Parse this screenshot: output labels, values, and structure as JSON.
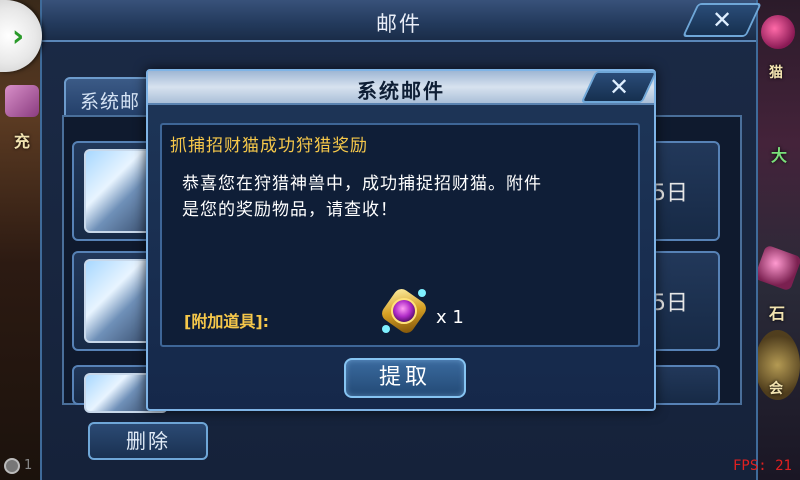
{
  "background": {
    "left_text": "充",
    "right_text_1": "猫",
    "right_text_2": "大",
    "right_text_3": "石",
    "right_text_4": "会"
  },
  "mail_panel": {
    "title": "邮件",
    "close_icon": "✕",
    "tab_label": "系统邮",
    "rows": [
      {
        "date": "5日"
      },
      {
        "date": "5日"
      },
      {
        "date": ""
      }
    ],
    "delete_label": "删除",
    "fps": "FPS: 21",
    "status_text": "1"
  },
  "back_button": {
    "icon": "chevron-right",
    "glyph": "›"
  },
  "dialog": {
    "title": "系统邮件",
    "close_icon": "✕",
    "subject": "抓捕招财猫成功狩猎奖励",
    "body_line1": "恭喜您在狩猎神兽中，成功捕捉招财猫。附件",
    "body_line2": "是您的奖励物品，请查收！",
    "attachment_label": "[附加道具]:",
    "attachment_qty": "x 1",
    "claim_label": "提取"
  },
  "colors": {
    "gold_text": "#f6c84a",
    "panel_border": "#7fb4e6",
    "fps_red": "#e02020"
  }
}
